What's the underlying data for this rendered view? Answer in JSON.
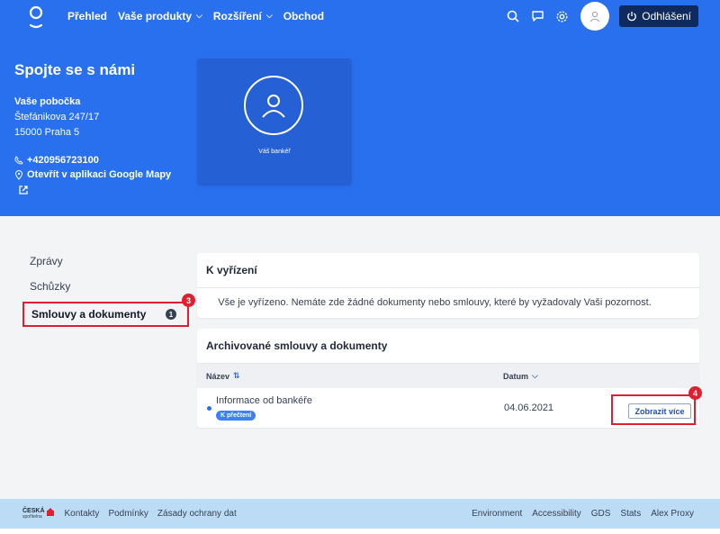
{
  "colors": {
    "primary": "#2870ed",
    "dark": "#0f2a5e",
    "highlight": "#e11d2f",
    "footer": "#bcdcf6"
  },
  "nav": {
    "items": [
      {
        "label": "Přehled",
        "has_dropdown": false
      },
      {
        "label": "Vaše produkty",
        "has_dropdown": true
      },
      {
        "label": "Rozšíření",
        "has_dropdown": true
      },
      {
        "label": "Obchod",
        "has_dropdown": false
      }
    ],
    "icons": [
      "search-icon",
      "chat-icon",
      "gear-icon",
      "user-icon",
      "power-icon"
    ],
    "logout_label": "Odhlášení"
  },
  "hero": {
    "title": "Spojte se s námi",
    "branch_title": "Vaše pobočka",
    "address_line1": "Štefánikova 247/17",
    "address_line2": "15000 Praha 5",
    "phone": "+420956723100",
    "map_link": "Otevřít v aplikaci Google Mapy",
    "banker_label": "Váš bankéř"
  },
  "sidebar": {
    "items": [
      {
        "label": "Zprávy"
      },
      {
        "label": "Schůzky"
      },
      {
        "label": "Smlouvy a dokumenty",
        "badge": "1",
        "active": true
      }
    ],
    "marker": "3"
  },
  "pending": {
    "title": "K vyřízení",
    "message": "Vše je vyřízeno. Nemáte zde žádné dokumenty nebo smlouvy, které by vyžadovaly Vaši pozornost."
  },
  "archive": {
    "title": "Archivované smlouvy a dokumenty",
    "columns": {
      "name": "Název",
      "date": "Datum"
    },
    "rows": [
      {
        "title": "Informace od bankéře",
        "tag": "K přečtení",
        "date": "04.06.2021",
        "action": "Zobrazit více"
      }
    ],
    "marker": "4"
  },
  "footer": {
    "brand": "ČESKÁ",
    "brand_sub": "spořitelna",
    "left_links": [
      "Kontakty",
      "Podmínky",
      "Zásady ochrany dat"
    ],
    "right_links": [
      "Environment",
      "Accessibility",
      "GDS",
      "Stats",
      "Alex Proxy"
    ]
  }
}
